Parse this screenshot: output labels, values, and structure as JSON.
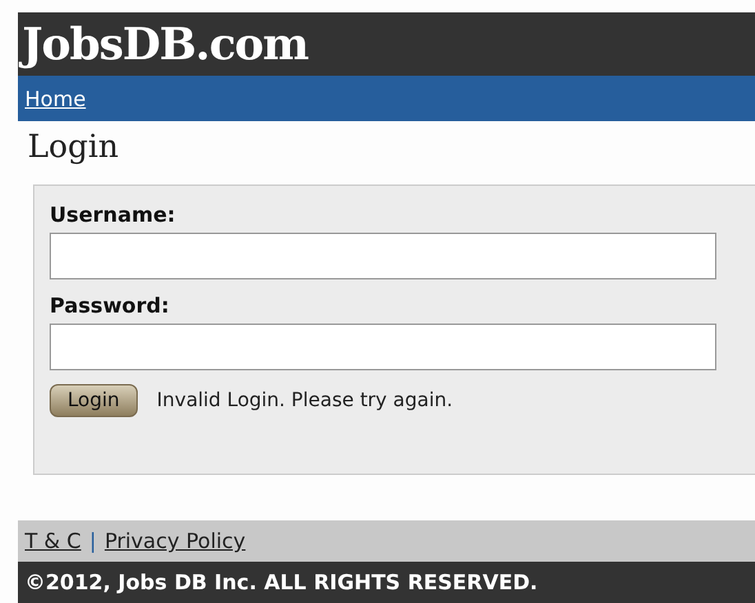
{
  "header": {
    "logo": "JobsDB.com"
  },
  "nav": {
    "links": [
      "Home"
    ]
  },
  "page_title": "Login",
  "form": {
    "fields": [
      {
        "label": "Username:"
      },
      {
        "label": "Password:"
      }
    ],
    "submit": "Login",
    "error": "Invalid Login. Please try again."
  },
  "footer": {
    "links": [
      "T & C",
      "Privacy Policy"
    ],
    "separator": "|",
    "copyright": "©2012, Jobs DB Inc. ALL RIGHTS RESERVED."
  }
}
